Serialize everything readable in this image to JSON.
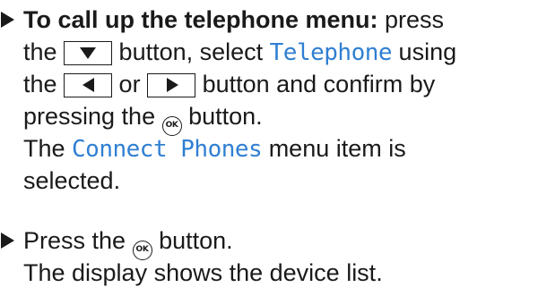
{
  "step1": {
    "heading": "To call up the telephone menu:",
    "t_press": " press",
    "t_the_a": "the ",
    "t_button_select": " button, select ",
    "menu_telephone": "Telephone",
    "t_using": " using",
    "t_the_b": "the ",
    "t_or": " or ",
    "t_button_confirm": " button and confirm by",
    "t_pressing_the": "pressing the ",
    "t_button_end": " button.",
    "result_prefix": "The ",
    "menu_connect_phones": "Connect Phones",
    "result_suffix": " menu item is",
    "result_end": "selected."
  },
  "step2": {
    "t_press_the": "Press the ",
    "t_button_end": " button.",
    "result": "The display shows the device list."
  },
  "icons": {
    "bullet": "step-arrow-icon",
    "down": "down-arrow-button-icon",
    "left": "left-arrow-button-icon",
    "right": "right-arrow-button-icon",
    "ok": "ok-button-icon",
    "ok_label": "OK"
  },
  "colors": {
    "display_text": "#2f7fd2",
    "body_text": "#1a1a1a"
  }
}
